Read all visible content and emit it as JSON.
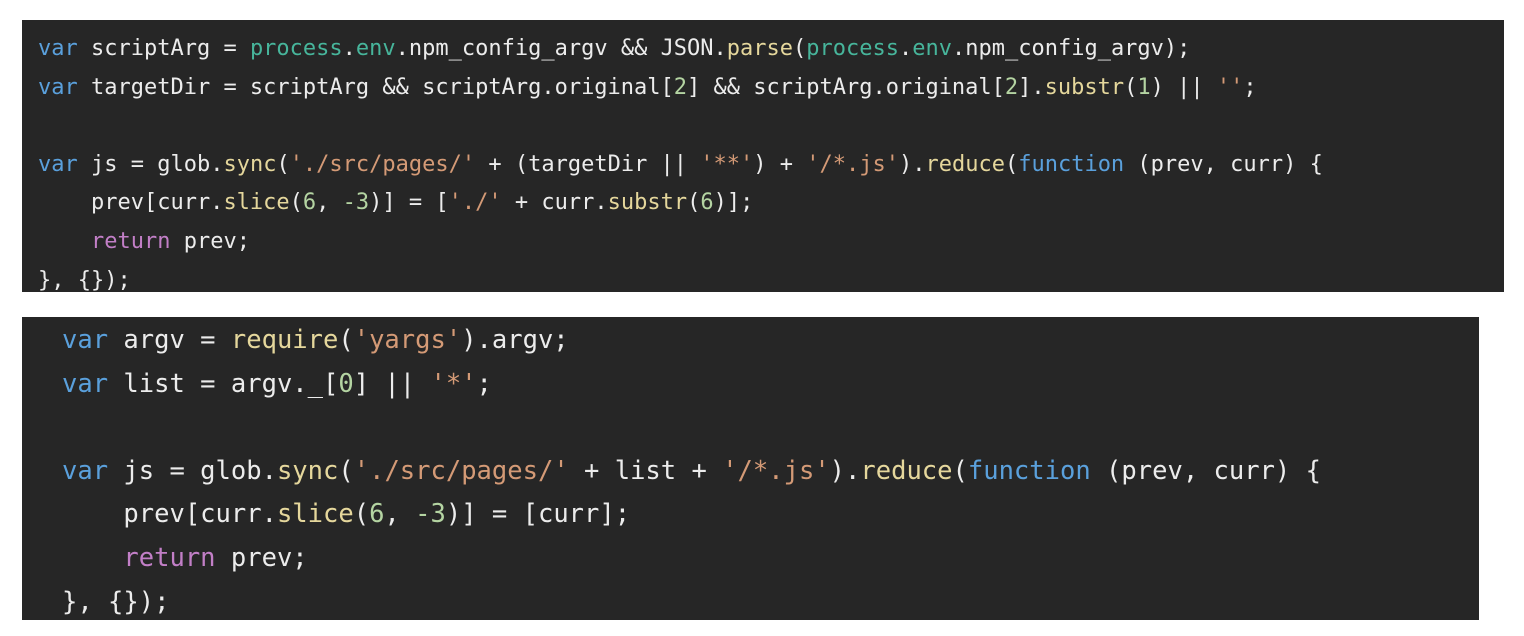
{
  "colors": {
    "background": "#262626",
    "keyword": "#5aa0dc",
    "property": "#47b59b",
    "function": "#e5d79c",
    "string": "#d49a76",
    "return": "#c27fc7",
    "number": "#b4d4a2",
    "identifier": "#ececec"
  },
  "snippets": [
    {
      "lines": [
        [
          {
            "t": "var",
            "c": "kw"
          },
          {
            "t": " scriptArg = ",
            "c": "id"
          },
          {
            "t": "process",
            "c": "prop"
          },
          {
            "t": ".",
            "c": "id"
          },
          {
            "t": "env",
            "c": "prop"
          },
          {
            "t": ".npm_config_argv && ",
            "c": "id"
          },
          {
            "t": "JSON",
            "c": "id"
          },
          {
            "t": ".",
            "c": "id"
          },
          {
            "t": "parse",
            "c": "fn"
          },
          {
            "t": "(",
            "c": "id"
          },
          {
            "t": "process",
            "c": "prop"
          },
          {
            "t": ".",
            "c": "id"
          },
          {
            "t": "env",
            "c": "prop"
          },
          {
            "t": ".npm_config_argv);",
            "c": "id"
          }
        ],
        [
          {
            "t": "var",
            "c": "kw"
          },
          {
            "t": " targetDir = scriptArg && scriptArg.original[",
            "c": "id"
          },
          {
            "t": "2",
            "c": "num"
          },
          {
            "t": "] && scriptArg.original[",
            "c": "id"
          },
          {
            "t": "2",
            "c": "num"
          },
          {
            "t": "].",
            "c": "id"
          },
          {
            "t": "substr",
            "c": "fn"
          },
          {
            "t": "(",
            "c": "id"
          },
          {
            "t": "1",
            "c": "num"
          },
          {
            "t": ") || ",
            "c": "id"
          },
          {
            "t": "''",
            "c": "str"
          },
          {
            "t": ";",
            "c": "id"
          }
        ],
        [],
        [
          {
            "t": "var",
            "c": "kw"
          },
          {
            "t": " js = glob.",
            "c": "id"
          },
          {
            "t": "sync",
            "c": "fn"
          },
          {
            "t": "(",
            "c": "id"
          },
          {
            "t": "'./src/pages/'",
            "c": "str"
          },
          {
            "t": " + (targetDir || ",
            "c": "id"
          },
          {
            "t": "'**'",
            "c": "str"
          },
          {
            "t": ") + ",
            "c": "id"
          },
          {
            "t": "'/*.js'",
            "c": "str"
          },
          {
            "t": ").",
            "c": "id"
          },
          {
            "t": "reduce",
            "c": "fn"
          },
          {
            "t": "(",
            "c": "id"
          },
          {
            "t": "function",
            "c": "kw"
          },
          {
            "t": " (prev, curr) {",
            "c": "id"
          }
        ],
        [
          {
            "t": "    prev[curr.",
            "c": "id"
          },
          {
            "t": "slice",
            "c": "fn"
          },
          {
            "t": "(",
            "c": "id"
          },
          {
            "t": "6",
            "c": "num"
          },
          {
            "t": ", ",
            "c": "id"
          },
          {
            "t": "-3",
            "c": "num"
          },
          {
            "t": ")] = [",
            "c": "id"
          },
          {
            "t": "'./'",
            "c": "str"
          },
          {
            "t": " + curr.",
            "c": "id"
          },
          {
            "t": "substr",
            "c": "fn"
          },
          {
            "t": "(",
            "c": "id"
          },
          {
            "t": "6",
            "c": "num"
          },
          {
            "t": ")];",
            "c": "id"
          }
        ],
        [
          {
            "t": "    ",
            "c": "id"
          },
          {
            "t": "return",
            "c": "ret"
          },
          {
            "t": " prev;",
            "c": "id"
          }
        ],
        [
          {
            "t": "}, {});",
            "c": "id"
          }
        ]
      ]
    },
    {
      "lines": [
        [
          {
            "t": "var",
            "c": "kw"
          },
          {
            "t": " argv = ",
            "c": "id"
          },
          {
            "t": "require",
            "c": "fn"
          },
          {
            "t": "(",
            "c": "id"
          },
          {
            "t": "'yargs'",
            "c": "str"
          },
          {
            "t": ").argv;",
            "c": "id"
          }
        ],
        [
          {
            "t": "var",
            "c": "kw"
          },
          {
            "t": " list = argv._[",
            "c": "id"
          },
          {
            "t": "0",
            "c": "num"
          },
          {
            "t": "] || ",
            "c": "id"
          },
          {
            "t": "'*'",
            "c": "str"
          },
          {
            "t": ";",
            "c": "id"
          }
        ],
        [],
        [
          {
            "t": "var",
            "c": "kw"
          },
          {
            "t": " js = glob.",
            "c": "id"
          },
          {
            "t": "sync",
            "c": "fn"
          },
          {
            "t": "(",
            "c": "id"
          },
          {
            "t": "'./src/pages/'",
            "c": "str"
          },
          {
            "t": " + list + ",
            "c": "id"
          },
          {
            "t": "'/*.js'",
            "c": "str"
          },
          {
            "t": ").",
            "c": "id"
          },
          {
            "t": "reduce",
            "c": "fn"
          },
          {
            "t": "(",
            "c": "id"
          },
          {
            "t": "function",
            "c": "kw"
          },
          {
            "t": " (prev, curr) {",
            "c": "id"
          }
        ],
        [
          {
            "t": "    prev[curr.",
            "c": "id"
          },
          {
            "t": "slice",
            "c": "fn"
          },
          {
            "t": "(",
            "c": "id"
          },
          {
            "t": "6",
            "c": "num"
          },
          {
            "t": ", ",
            "c": "id"
          },
          {
            "t": "-3",
            "c": "num"
          },
          {
            "t": ")] = [curr];",
            "c": "id"
          }
        ],
        [
          {
            "t": "    ",
            "c": "id"
          },
          {
            "t": "return",
            "c": "ret"
          },
          {
            "t": " prev;",
            "c": "id"
          }
        ],
        [
          {
            "t": "}, {});",
            "c": "id"
          }
        ]
      ]
    }
  ]
}
